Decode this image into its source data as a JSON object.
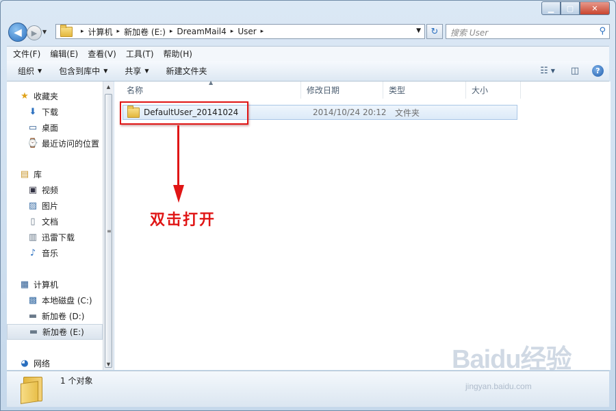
{
  "window": {
    "controls": {
      "minimize": "▁",
      "maximize": "▢",
      "close": "✕"
    }
  },
  "nav": {
    "back_icon": "◀",
    "forward_icon": "▶",
    "history_icon": "▼",
    "address": {
      "crumbs": [
        "计算机",
        "新加卷 (E:)",
        "DreamMail4",
        "User"
      ],
      "separator": "▸"
    },
    "refresh_icon": "↻",
    "search": {
      "placeholder": "搜索 User",
      "icon": "⚲"
    }
  },
  "menubar": [
    "文件(F)",
    "编辑(E)",
    "查看(V)",
    "工具(T)",
    "帮助(H)"
  ],
  "toolbar": {
    "items": [
      {
        "label": "组织",
        "has_dropdown": true
      },
      {
        "label": "包含到库中",
        "has_dropdown": true
      },
      {
        "label": "共享",
        "has_dropdown": true
      },
      {
        "label": "新建文件夹",
        "has_dropdown": false
      }
    ],
    "dropdown_glyph": "▼",
    "view_icon": "☷",
    "preview_icon": "◫",
    "help_icon": "?"
  },
  "sidebar": {
    "favorites": {
      "label": "收藏夹",
      "icon": "★",
      "items": [
        {
          "label": "下载",
          "icon": "⬇"
        },
        {
          "label": "桌面",
          "icon": "▭"
        },
        {
          "label": "最近访问的位置",
          "icon": "⌚"
        }
      ]
    },
    "libraries": {
      "label": "库",
      "icon": "▤",
      "items": [
        {
          "label": "视频",
          "icon": "▣"
        },
        {
          "label": "图片",
          "icon": "▨"
        },
        {
          "label": "文档",
          "icon": "▯"
        },
        {
          "label": "迅雷下载",
          "icon": "▥"
        },
        {
          "label": "音乐",
          "icon": "♪"
        }
      ]
    },
    "computer": {
      "label": "计算机",
      "icon": "▦",
      "items": [
        {
          "label": "本地磁盘 (C:)",
          "icon": "▩"
        },
        {
          "label": "新加卷 (D:)",
          "icon": "▬"
        },
        {
          "label": "新加卷 (E:)",
          "icon": "▬",
          "selected": true
        }
      ]
    },
    "network": {
      "label": "网络",
      "icon": "◕"
    }
  },
  "scrollbar": {
    "up": "▲",
    "down": "▼",
    "grip": "≡"
  },
  "filelist": {
    "columns": [
      "名称",
      "修改日期",
      "类型",
      "大小"
    ],
    "sort_indicator": "▲",
    "rows": [
      {
        "name": "DefaultUser_20141024",
        "modified": "2014/10/24 20:12",
        "type": "文件夹",
        "size": ""
      }
    ]
  },
  "annotation": {
    "text": "双击打开"
  },
  "status": {
    "text": "1 个对象"
  },
  "watermark": {
    "logo": "Baidu经验",
    "url": "jingyan.baidu.com"
  }
}
